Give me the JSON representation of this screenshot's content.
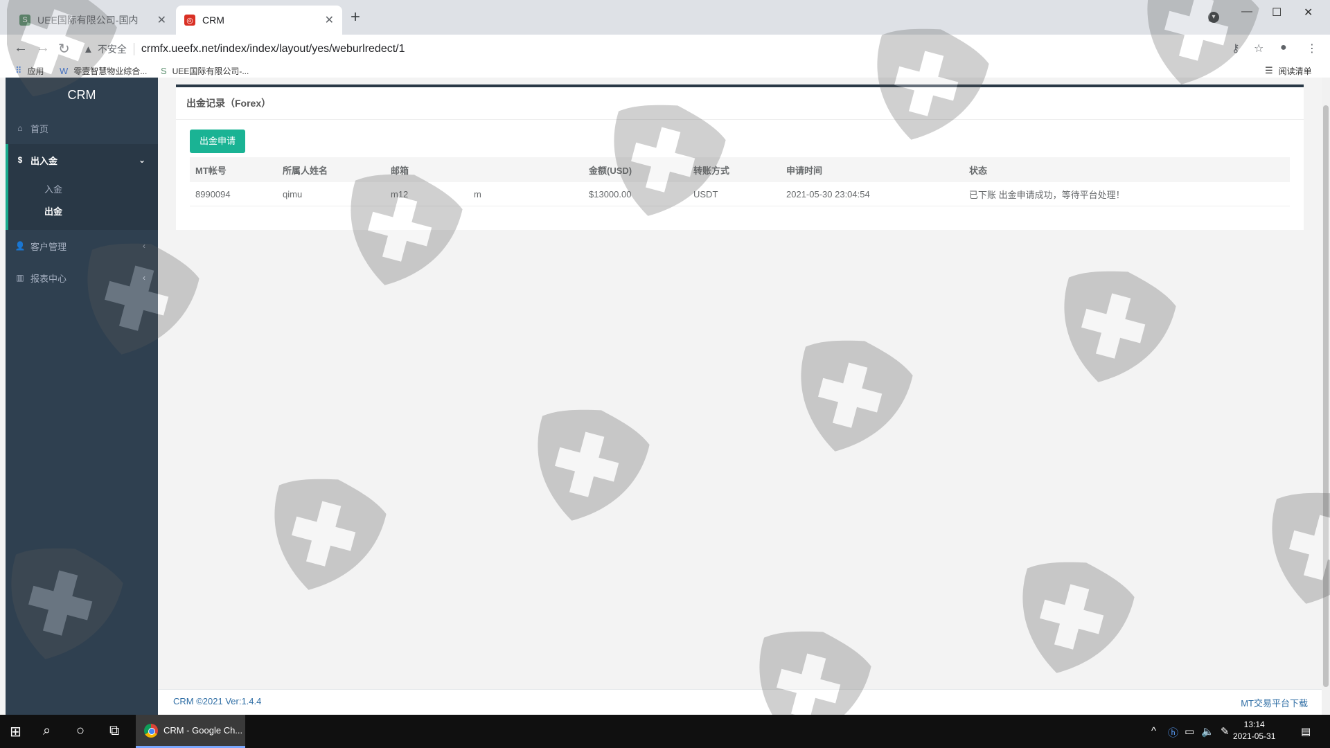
{
  "browser": {
    "tabs": [
      {
        "label": "UEE国际有限公司-国内",
        "active": false
      },
      {
        "label": "CRM",
        "active": true
      }
    ],
    "new_tab": "+",
    "security_label": "不安全",
    "url": "crmfx.ueefx.net/index/index/layout/yes/weburlredect/1",
    "bookmarks": [
      {
        "label": "应用"
      },
      {
        "label": "零壹智慧物业综合..."
      },
      {
        "label": "UEE国际有限公司-..."
      }
    ],
    "reading_list": "阅读清单"
  },
  "sidebar": {
    "brand": "CRM",
    "items": [
      {
        "label": "首页",
        "icon": "home-icon"
      },
      {
        "label": "出入金",
        "icon": "dollar-icon",
        "expanded": true,
        "children": [
          {
            "label": "入金"
          },
          {
            "label": "出金",
            "current": true
          }
        ]
      },
      {
        "label": "客户管理",
        "icon": "user-icon"
      },
      {
        "label": "报表中心",
        "icon": "bar-chart-icon"
      }
    ]
  },
  "panel": {
    "title": "出金记录（Forex）",
    "apply_button": "出金申请",
    "columns": [
      "MT帐号",
      "所属人姓名",
      "邮箱",
      "",
      "金额(USD)",
      "转账方式",
      "申请时间",
      "状态"
    ],
    "rows": [
      [
        "8990094",
        "qimu",
        "m12",
        "m",
        "$13000.00",
        "USDT",
        "2021-05-30 23:04:54",
        "已下账 出金申请成功，等待平台处理！"
      ]
    ]
  },
  "footer": {
    "copyright": "CRM ©2021 Ver:1.4.4",
    "download": "MT交易平台下载"
  },
  "taskbar": {
    "app_label": "CRM - Google Ch...",
    "time": "13:14",
    "date": "2021-05-31"
  },
  "colors": {
    "sidebar": "#2f4050",
    "accent": "#1ab394",
    "link": "#2e6da4"
  }
}
